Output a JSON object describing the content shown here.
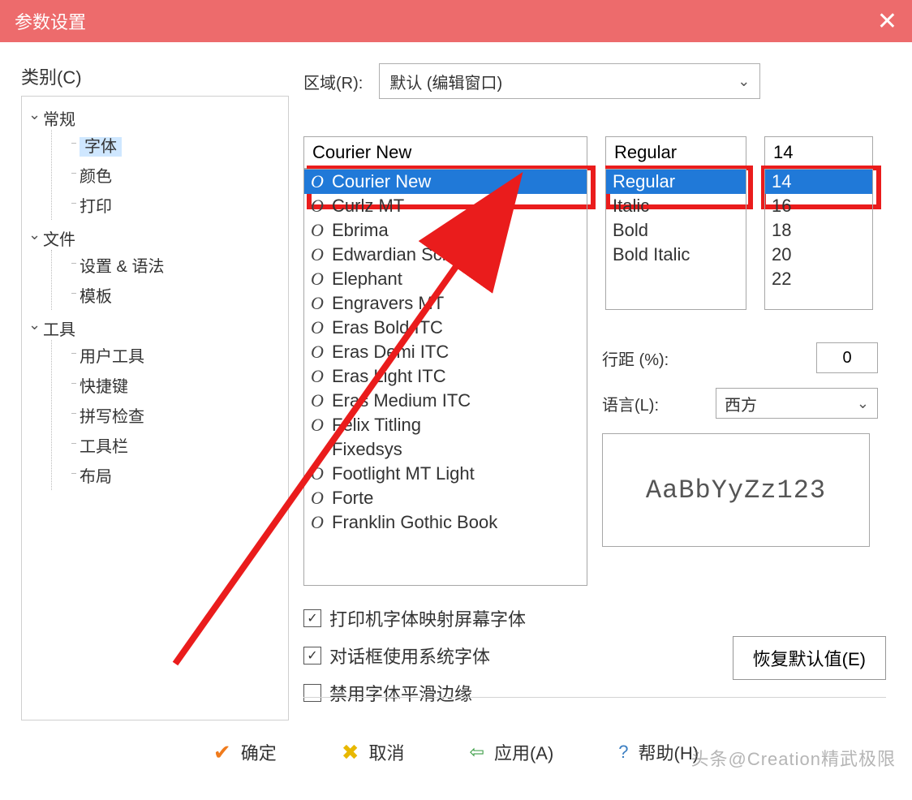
{
  "title": "参数设置",
  "left": {
    "label": "类别(C)",
    "general": "常规",
    "font": "字体",
    "color": "颜色",
    "print": "打印",
    "file": "文件",
    "settings_grammar": "设置 & 语法",
    "template": "模板",
    "tool": "工具",
    "user_tool": "用户工具",
    "shortcut": "快捷键",
    "spell": "拼写检查",
    "toolbar": "工具栏",
    "layout": "布局"
  },
  "region": {
    "label": "区域(R):",
    "value": "默认 (编辑窗口)"
  },
  "font_input": "Courier New",
  "style_input": "Regular",
  "size_input": "14",
  "fonts": [
    "Courier New",
    "Curlz MT",
    "Ebrima",
    "Edwardian Script ITC",
    "Elephant",
    "Engravers MT",
    "Eras Bold ITC",
    "Eras Demi ITC",
    "Eras Light ITC",
    "Eras Medium ITC",
    "Felix Titling",
    "Fixedsys",
    "Footlight MT Light",
    "Forte",
    "Franklin Gothic Book"
  ],
  "styles": [
    "Regular",
    "Italic",
    "Bold",
    "Bold Italic"
  ],
  "sizes": [
    "14",
    "16",
    "18",
    "20",
    "22"
  ],
  "line_spacing_label": "行距 (%):",
  "line_spacing_value": "0",
  "language_label": "语言(L):",
  "language_value": "西方",
  "preview": "AaBbYyZz123",
  "checks": {
    "c1": "打印机字体映射屏幕字体",
    "c2": "对话框使用系统字体",
    "c3": "禁用字体平滑边缘"
  },
  "restore": "恢复默认值(E)",
  "buttons": {
    "ok": "确定",
    "cancel": "取消",
    "apply": "应用(A)",
    "help": "帮助(H)"
  },
  "watermark": "头条@Creation精武极限"
}
